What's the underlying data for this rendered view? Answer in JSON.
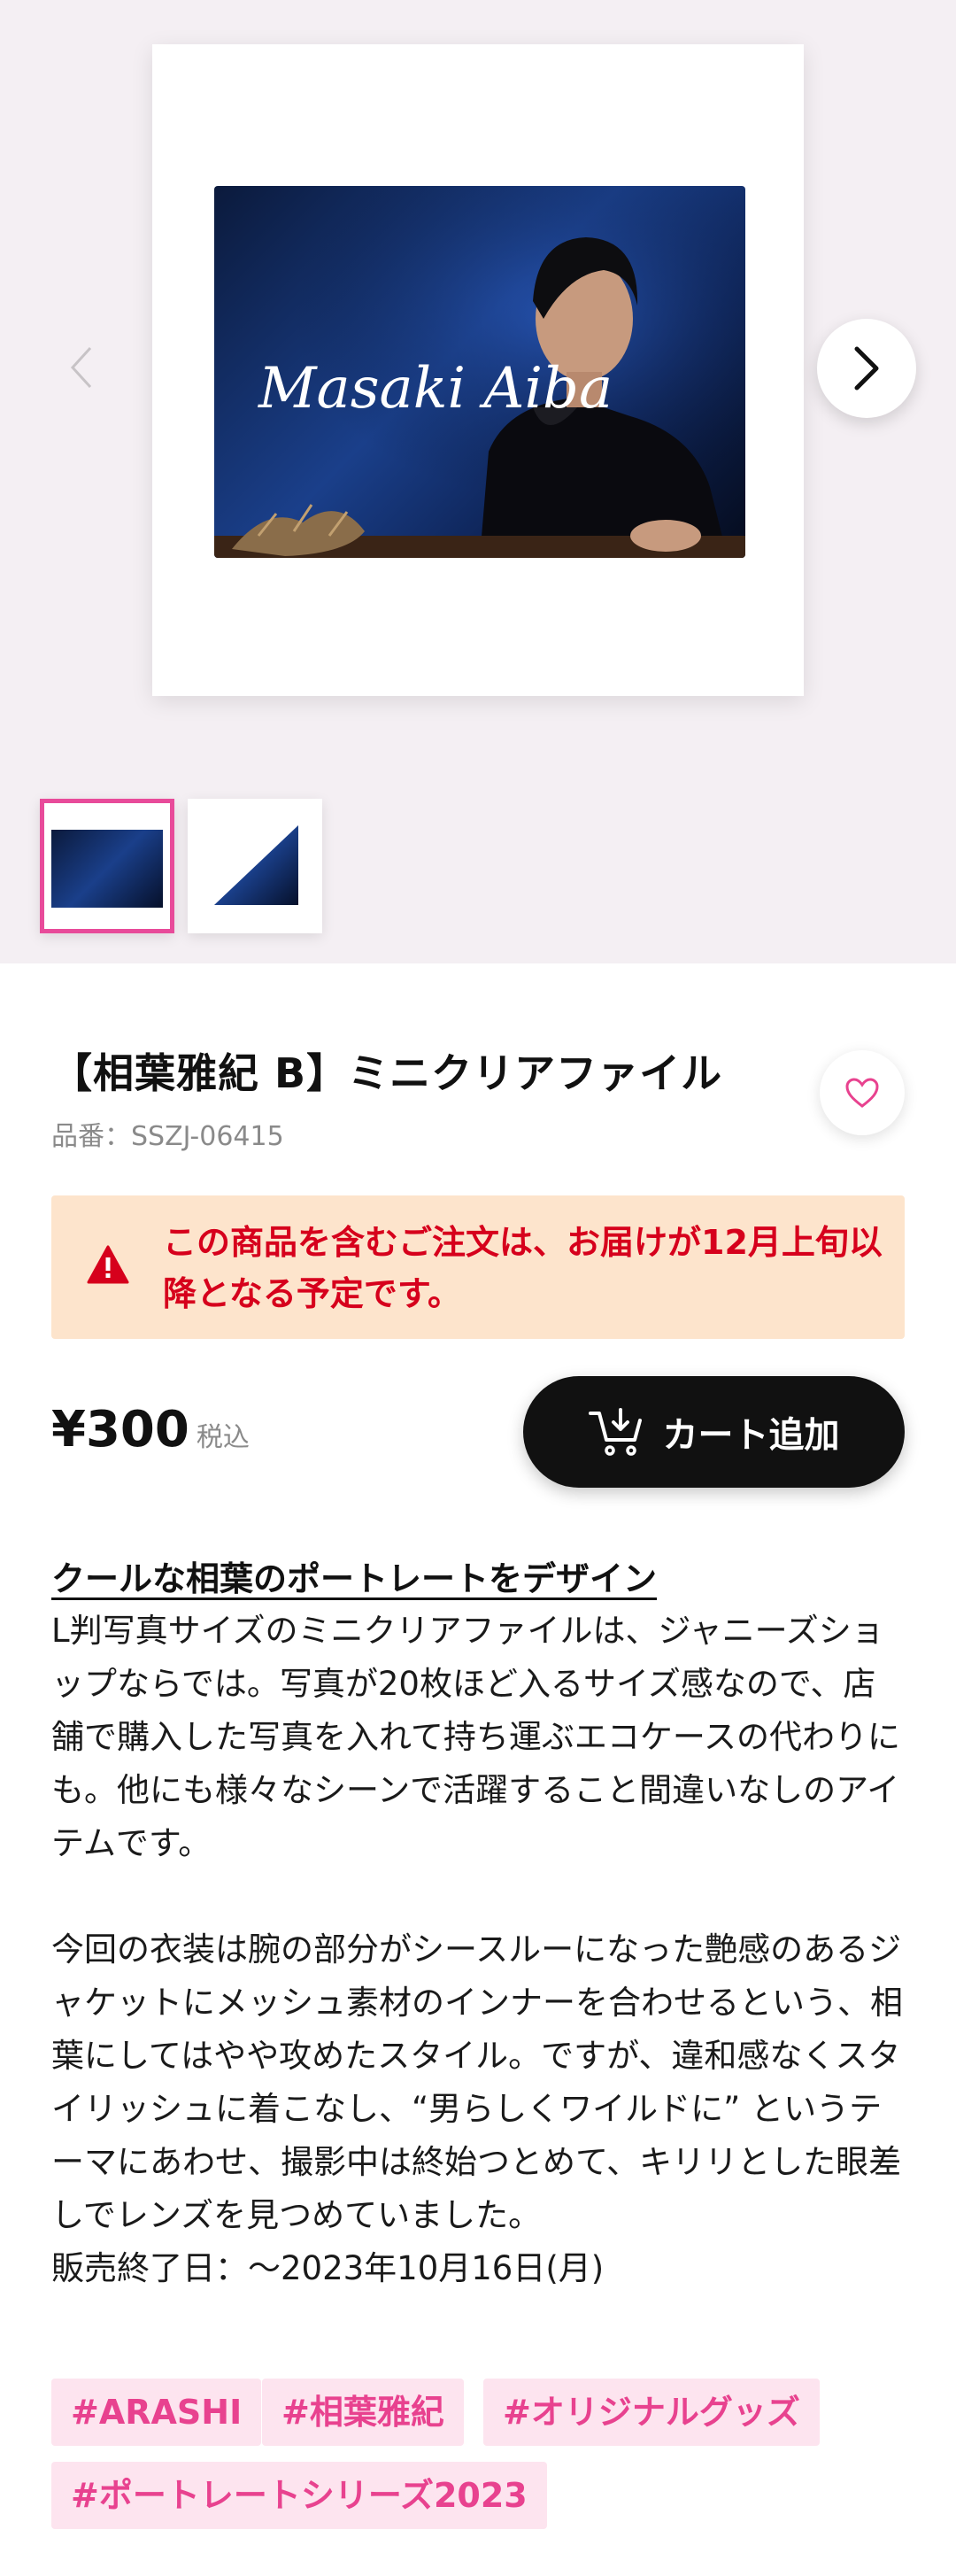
{
  "product": {
    "title": "【相葉雅紀 B】ミニクリアファイル",
    "sku": "品番：SSZJ-06415",
    "notice": "この商品を含むご注文は、お届けが12月上旬以降となる予定です。",
    "price": "¥300",
    "tax_label": "税込",
    "cart_label": "カート追加",
    "photo_signature": "Masaki Aiba"
  },
  "description": {
    "heading": "クールな相葉のポートレートをデザイン",
    "para1": "L判写真サイズのミニクリアファイルは、ジャニーズショップならでは。写真が20枚ほど入るサイズ感なので、店舗で購入した写真を入れて持ち運ぶエコケースの代わりにも。他にも様々なシーンで活躍すること間違いなしのアイテムです。",
    "para2": "今回の衣装は腕の部分がシースルーになった艶感のあるジャケットにメッシュ素材のインナーを合わせるという、相葉にしてはやや攻めたスタイル。ですが、違和感なくスタイリッシュに着こなし、“男らしくワイルドに” というテーマにあわせ、撮影中は終始つとめて、キリリとした眼差しでレンズを見つめていました。",
    "sale_end": "販売終了日：〜2023年10月16日(月)"
  },
  "tags": [
    "#ARASHI",
    "#相葉雅紀",
    "#オリジナルグッズ",
    "#ポートレートシリーズ2023"
  ],
  "colors": {
    "accent_pink": "#e84b9a",
    "notice_bg": "#fde4cc",
    "notice_text": "#d6001c",
    "tag_bg": "#fde4ef",
    "tag_text": "#e8428f",
    "gallery_bg": "#f4eff3"
  },
  "icons": {
    "prev": "chevron-left-icon",
    "next": "chevron-right-icon",
    "favorite": "heart-outline-icon",
    "warning": "warning-triangle-icon",
    "cart": "cart-add-icon"
  }
}
